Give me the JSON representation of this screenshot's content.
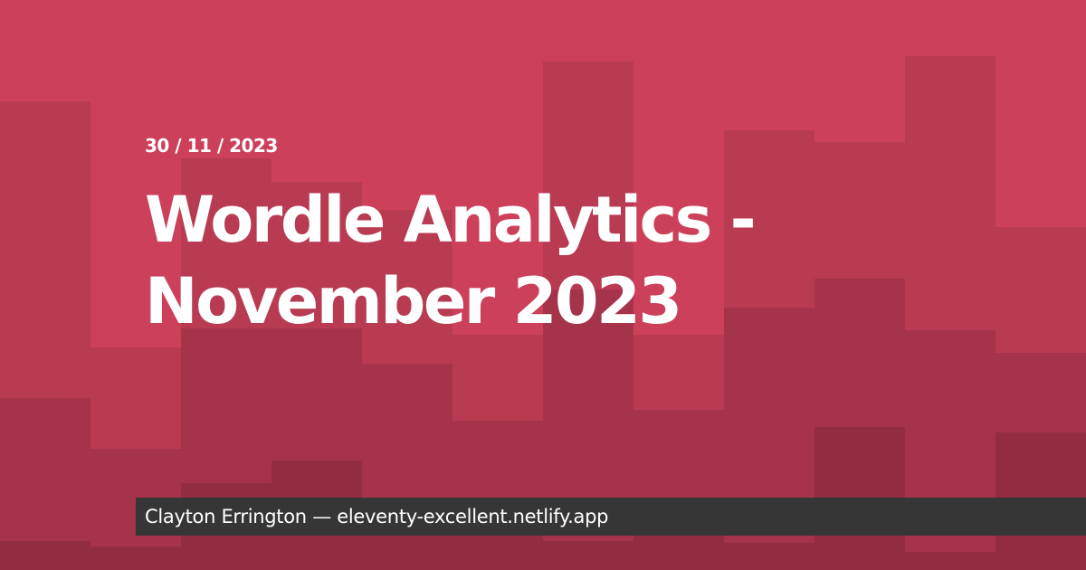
{
  "post": {
    "date": "30 / 11 / 2023",
    "title_line_1": "Wordle Analytics -",
    "title_line_2": "November 2023"
  },
  "footer": {
    "author": "Clayton Errington",
    "separator": "—",
    "site": "eleventy-excellent.netlify.app"
  },
  "colors": {
    "background": "#cd405a",
    "shade_1": "#b83b52",
    "shade_2": "#a5344a",
    "shade_3": "#912c41",
    "footer_bar": "#363636",
    "text": "#ffffff"
  }
}
